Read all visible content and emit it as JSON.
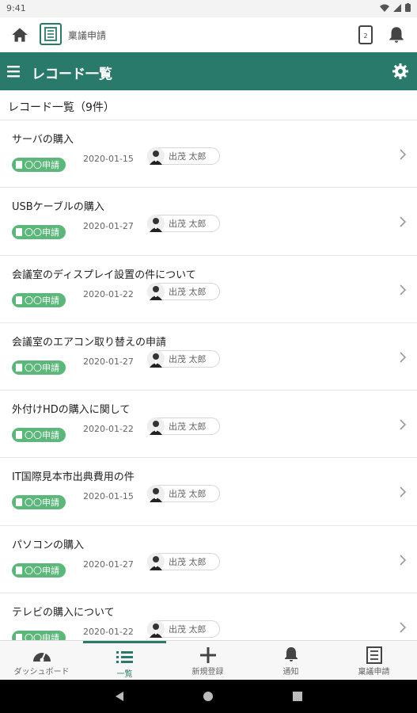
{
  "status_bar": {
    "time": "9:41"
  },
  "app_bar": {
    "app_name": "稟議申請"
  },
  "title_bar": {
    "title": "レコード一覧"
  },
  "list": {
    "header": "レコード一覧（9件）",
    "rows": [
      {
        "title": "サーバの購入",
        "badge": "〇〇申請",
        "date": "2020-01-15",
        "user": "出茂 太郎"
      },
      {
        "title": "USBケーブルの購入",
        "badge": "〇〇申請",
        "date": "2020-01-27",
        "user": "出茂 太郎"
      },
      {
        "title": "会議室のディスプレイ設置の件について",
        "badge": "〇〇申請",
        "date": "2020-01-22",
        "user": "出茂 太郎"
      },
      {
        "title": "会議室のエアコン取り替えの申請",
        "badge": "〇〇申請",
        "date": "2020-01-27",
        "user": "出茂 太郎"
      },
      {
        "title": "外付けHDの購入に関して",
        "badge": "〇〇申請",
        "date": "2020-01-22",
        "user": "出茂 太郎"
      },
      {
        "title": "IT国際見本市出典費用の件",
        "badge": "〇〇申請",
        "date": "2020-01-15",
        "user": "出茂 太郎"
      },
      {
        "title": "パソコンの購入",
        "badge": "〇〇申請",
        "date": "2020-01-27",
        "user": "出茂 太郎"
      },
      {
        "title": "テレビの購入について",
        "badge": "〇〇申請",
        "date": "2020-01-22",
        "user": "出茂 太郎"
      }
    ]
  },
  "bottom_nav": {
    "items": [
      {
        "label": "ダッシュボード",
        "icon": "dashboard-icon"
      },
      {
        "label": "一覧",
        "icon": "list-icon",
        "active": true
      },
      {
        "label": "新規登録",
        "icon": "plus-icon"
      },
      {
        "label": "通知",
        "icon": "bell-icon"
      },
      {
        "label": "稟議申請",
        "icon": "app-icon"
      }
    ]
  },
  "colors": {
    "primary": "#2a7a6b",
    "badge": "#5cb87a",
    "divider": "#e6e6e6"
  }
}
